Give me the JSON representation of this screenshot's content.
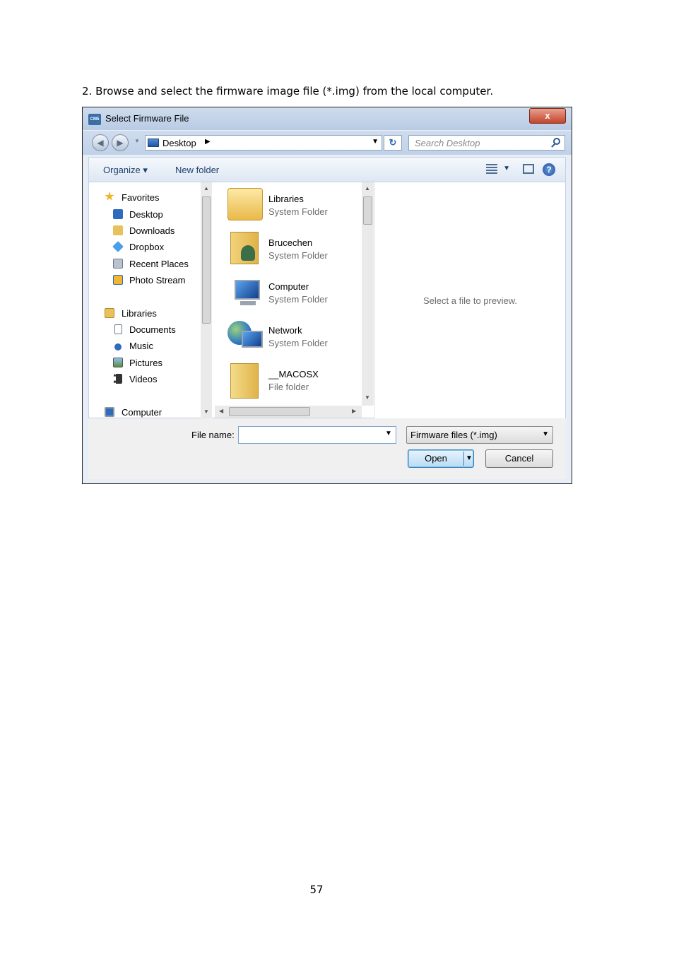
{
  "instruction": "2. Browse and select the firmware image file (*.img) from the local computer.",
  "page_number": "57",
  "dialog": {
    "title": "Select Firmware File",
    "app_icon_text": "CM5",
    "close_label": "x",
    "address": {
      "location": "Desktop",
      "search_placeholder": "Search Desktop"
    },
    "toolbar": {
      "organize_label": "Organize ▾",
      "new_folder_label": "New folder"
    },
    "nav": {
      "favorites": "Favorites",
      "desktop": "Desktop",
      "downloads": "Downloads",
      "dropbox": "Dropbox",
      "recent_places": "Recent Places",
      "photo_stream": "Photo Stream",
      "libraries": "Libraries",
      "documents": "Documents",
      "music": "Music",
      "pictures": "Pictures",
      "videos": "Videos",
      "computer": "Computer"
    },
    "files": [
      {
        "name": "Libraries",
        "type": "System Folder",
        "icon": "libraries-icon"
      },
      {
        "name": "Brucechen",
        "type": "System Folder",
        "icon": "user-folder-icon"
      },
      {
        "name": "Computer",
        "type": "System Folder",
        "icon": "computer-icon"
      },
      {
        "name": "Network",
        "type": "System Folder",
        "icon": "network-icon"
      },
      {
        "name": "__MACOSX",
        "type": "File folder",
        "icon": "folder-icon"
      }
    ],
    "preview_text": "Select a file to preview.",
    "file_name_label": "File name:",
    "file_name_value": "",
    "file_type_selected": "Firmware files (*.img)",
    "open_label": "Open",
    "cancel_label": "Cancel",
    "colors": {
      "accent": "#3c7fb1",
      "title_bar": "#c3d4ea"
    }
  }
}
